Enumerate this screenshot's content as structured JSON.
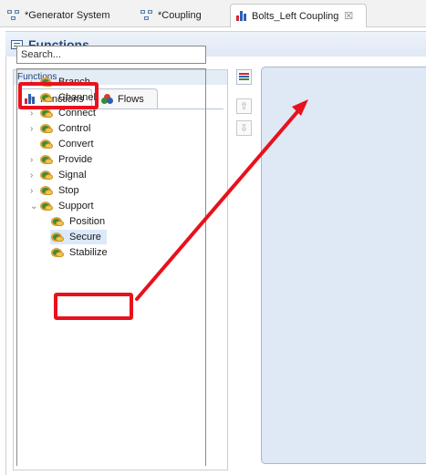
{
  "editor_tabs": [
    {
      "label": "*Generator System"
    },
    {
      "label": "*Coupling"
    },
    {
      "label": "Bolts_Left Coupling",
      "close": "☒"
    }
  ],
  "header": {
    "title": "Functions"
  },
  "panel": {
    "title": "Functions",
    "tabs": [
      {
        "label": "Functions"
      },
      {
        "label": "Flows"
      }
    ],
    "search": {
      "placeholder": "Search..."
    }
  },
  "tree": {
    "items": [
      {
        "label": "Branch"
      },
      {
        "label": "Channel"
      },
      {
        "label": "Connect"
      },
      {
        "label": "Control"
      },
      {
        "label": "Convert"
      },
      {
        "label": "Provide"
      },
      {
        "label": "Signal"
      },
      {
        "label": "Stop"
      },
      {
        "label": "Support"
      },
      {
        "label": "Position"
      },
      {
        "label": "Secure"
      },
      {
        "label": "Stabilize"
      }
    ]
  },
  "colors": {
    "highlight": "#e8111c",
    "canvas": "#dfe8f5",
    "header_text": "#2a4a7c"
  }
}
